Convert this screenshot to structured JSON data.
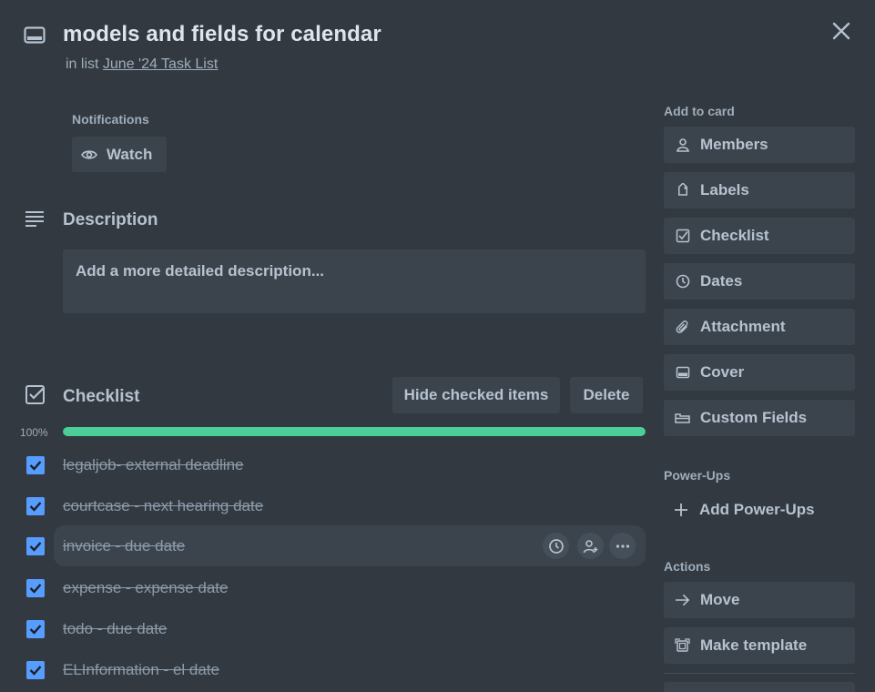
{
  "card": {
    "title": "models and fields for calendar",
    "in_list_prefix": "in list ",
    "list_name": "June '24 Task List"
  },
  "notifications": {
    "label": "Notifications",
    "watch_label": "Watch"
  },
  "description": {
    "heading": "Description",
    "placeholder": "Add a more detailed description..."
  },
  "checklist": {
    "heading": "Checklist",
    "hide_checked_label": "Hide checked items",
    "delete_label": "Delete",
    "percent_label": "100%",
    "progress": 1.0,
    "items": [
      {
        "text": "legaljob- external deadline",
        "checked": true
      },
      {
        "text": "courtcase - next hearing date",
        "checked": true
      },
      {
        "text": "invoice - due date",
        "checked": true
      },
      {
        "text": "expense - expense date",
        "checked": true
      },
      {
        "text": "todo - due date",
        "checked": true
      },
      {
        "text": "ELInformation - el date",
        "checked": true
      }
    ]
  },
  "sidebar": {
    "add_to_card_label": "Add to card",
    "add_to_card": [
      {
        "label": "Members",
        "icon": "person-icon"
      },
      {
        "label": "Labels",
        "icon": "tag-icon"
      },
      {
        "label": "Checklist",
        "icon": "checkbox-icon"
      },
      {
        "label": "Dates",
        "icon": "clock-icon"
      },
      {
        "label": "Attachment",
        "icon": "paperclip-icon"
      },
      {
        "label": "Cover",
        "icon": "cover-icon"
      },
      {
        "label": "Custom Fields",
        "icon": "custom-fields-icon"
      }
    ],
    "power_ups_label": "Power-Ups",
    "add_power_ups": "Add Power-Ups",
    "actions_label": "Actions",
    "actions": [
      {
        "label": "Move",
        "icon": "arrow-right-icon"
      },
      {
        "label": "Make template",
        "icon": "template-icon"
      }
    ]
  },
  "colors": {
    "background": "#323940",
    "button": "#3b444d",
    "progress": "#4bce97",
    "checkbox": "#579dff"
  }
}
